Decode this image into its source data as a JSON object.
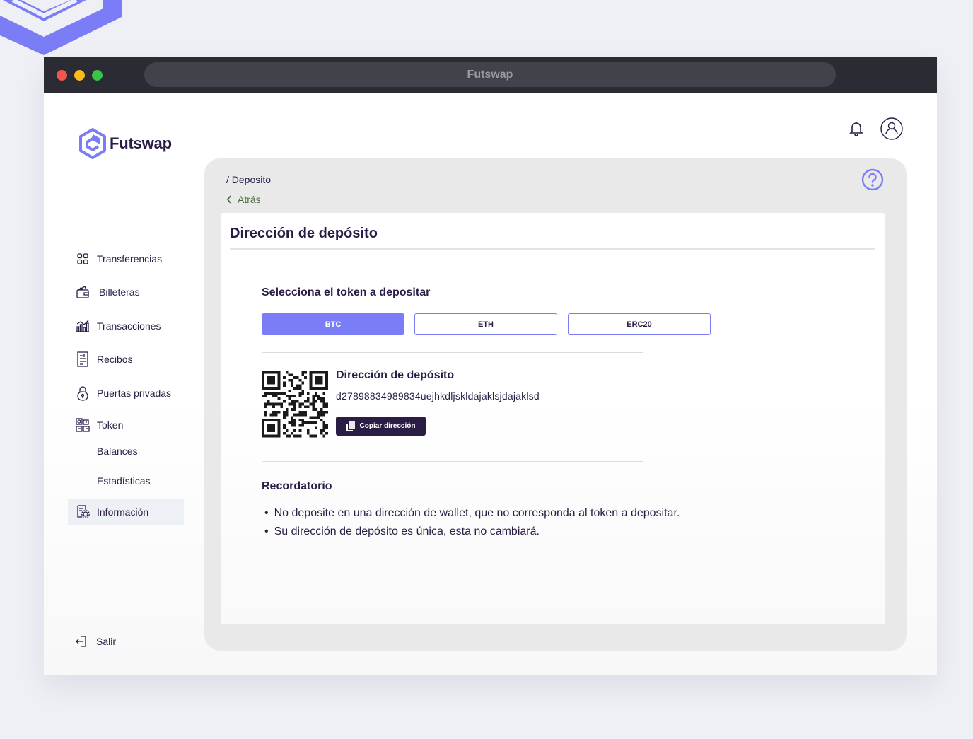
{
  "browser": {
    "title": "Futswap"
  },
  "brand": {
    "name": "Futswap",
    "accent": "#7a7df5",
    "dark": "#2a1c45"
  },
  "sidebar": {
    "items": [
      {
        "label": "Transferencias",
        "icon": "grid-icon"
      },
      {
        "label": "Billeteras",
        "icon": "wallet-icon"
      },
      {
        "label": "Transacciones",
        "icon": "chart-icon"
      },
      {
        "label": "Recibos",
        "icon": "receipt-icon"
      },
      {
        "label": "Puertas privadas",
        "icon": "lock-icon"
      },
      {
        "label": "Token",
        "icon": "token-icon"
      },
      {
        "label": "Balances"
      },
      {
        "label": "Estadísticas"
      },
      {
        "label": "Información",
        "icon": "info-settings-icon",
        "active": true
      }
    ],
    "logout": "Salir"
  },
  "header": {
    "icons": [
      "bell-icon",
      "user-icon"
    ]
  },
  "panel": {
    "breadcrumb": "/ Deposito",
    "back": "Atrás",
    "card": {
      "title": "Dirección de depósito",
      "select_label": "Selecciona el token a depositar",
      "tokens": [
        {
          "label": "BTC",
          "selected": true
        },
        {
          "label": "ETH",
          "selected": false
        },
        {
          "label": "ERC20",
          "selected": false
        }
      ],
      "deposit": {
        "title": "Dirección de depósito",
        "address": "d27898834989834uejhkdljskldajaklsjdajaklsd",
        "copy_label": "Copiar dirección"
      },
      "reminder": {
        "title": "Recordatorio",
        "items": [
          "No deposite en una dirección de wallet, que no corresponda al token a depositar.",
          "Su dirección de depósito es única, esta no cambiará."
        ]
      }
    }
  }
}
